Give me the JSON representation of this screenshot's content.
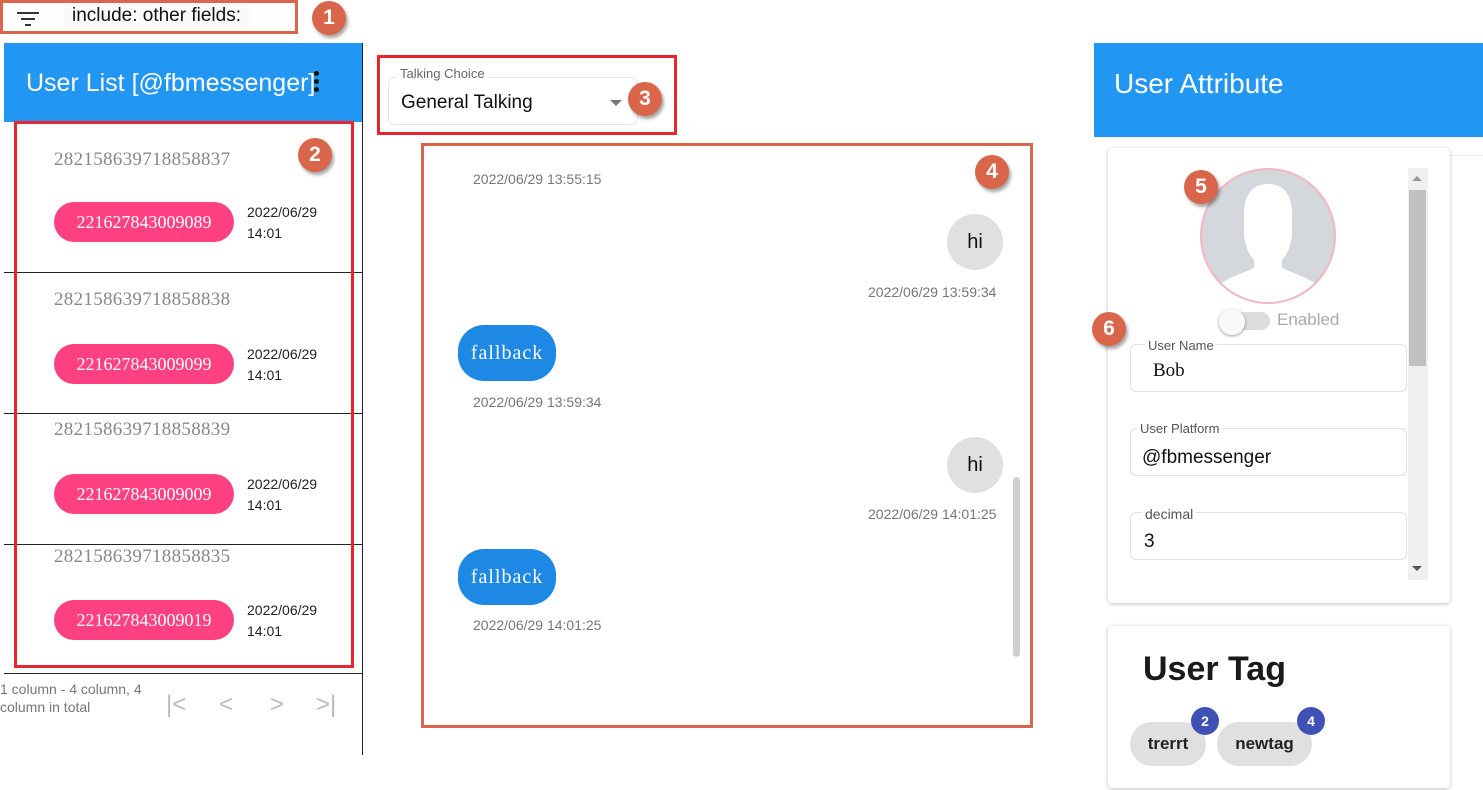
{
  "filter_bar": {
    "icon": "filter-list-icon",
    "text": "include:   other fields:"
  },
  "markers": [
    "1",
    "2",
    "3",
    "4",
    "5",
    "6"
  ],
  "user_list": {
    "title": "User List [@fbmessenger]",
    "menu_icon": "more-vert-icon",
    "users": [
      {
        "id": "282158639718858837",
        "chip": "221627843009089",
        "date": "2022/06/29",
        "time": "14:01"
      },
      {
        "id": "282158639718858838",
        "chip": "221627843009099",
        "date": "2022/06/29",
        "time": "14:01"
      },
      {
        "id": "282158639718858839",
        "chip": "221627843009009",
        "date": "2022/06/29",
        "time": "14:01"
      },
      {
        "id": "282158639718858835",
        "chip": "221627843009019",
        "date": "2022/06/29",
        "time": "14:01"
      }
    ],
    "pagination": {
      "summary": "1 column - 4 column, 4 column in total",
      "first": "|<",
      "prev": "<",
      "next": ">",
      "last": ">|"
    }
  },
  "talking_choice": {
    "label": "Talking Choice",
    "value": "General Talking",
    "icon": "dropdown-arrow-icon"
  },
  "chat": {
    "messages": [
      {
        "side": "left",
        "text": "",
        "timestamp": "2022/06/29 13:55:15"
      },
      {
        "side": "right",
        "text": "hi",
        "timestamp": "2022/06/29 13:59:34"
      },
      {
        "side": "left",
        "text": "fallback",
        "timestamp": "2022/06/29 13:59:34"
      },
      {
        "side": "right",
        "text": "hi",
        "timestamp": "2022/06/29 14:01:25"
      },
      {
        "side": "left",
        "text": "fallback",
        "timestamp": "2022/06/29 14:01:25"
      }
    ]
  },
  "user_attribute": {
    "title": "User Attribute",
    "avatar_icon": "default-user-avatar-icon",
    "toggle_label": "Enabled",
    "toggle_on": false,
    "fields": [
      {
        "label": "User Name",
        "value": "Bob"
      },
      {
        "label": "User Platform",
        "value": "@fbmessenger"
      },
      {
        "label": "decimal",
        "value": "3"
      }
    ]
  },
  "user_tag": {
    "title": "User Tag",
    "tags": [
      {
        "label": "trerrt",
        "count": "2"
      },
      {
        "label": "newtag",
        "count": "4"
      }
    ]
  },
  "colors": {
    "header_blue": "#2196f3",
    "chip_pink": "#ff4081",
    "bot_bubble": "#1e88e5",
    "user_bubble": "#e0e0e0",
    "badge_indigo": "#3f51b5",
    "marker_orange": "#d9664a",
    "highlight_red": "#e5262c"
  }
}
